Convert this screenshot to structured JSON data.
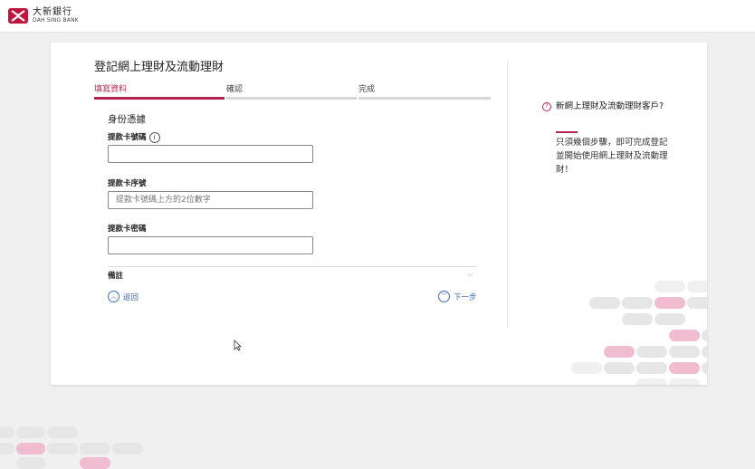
{
  "header": {
    "bank_name_zh": "大新銀行",
    "bank_name_en": "DAH SING BANK"
  },
  "page": {
    "title": "登記網上理財及流動理財"
  },
  "steps": [
    {
      "label": "填寫資料",
      "active": true
    },
    {
      "label": "確認",
      "active": false
    },
    {
      "label": "完成",
      "active": false
    }
  ],
  "form": {
    "section_title": "身份憑據",
    "card_number_label": "提款卡號碼",
    "card_number_value": "",
    "card_serial_label": "提款卡序號",
    "card_serial_placeholder": "提款卡號碼上方的2位數字",
    "card_pin_label": "提款卡密碼",
    "card_pin_value": "",
    "remarks_label": "備註",
    "back_label": "返回",
    "next_label": "下一步"
  },
  "sidebar": {
    "title": "新網上理財及流動理財客戶?",
    "description": "只須幾個步驟，即可完成登記並開始使用網上理財及流動理財！"
  },
  "colors": {
    "accent": "#b3254f",
    "link": "#3f6bb5",
    "pill_pink": "#efbdcf",
    "pill_grey": "#e6e6e6"
  }
}
